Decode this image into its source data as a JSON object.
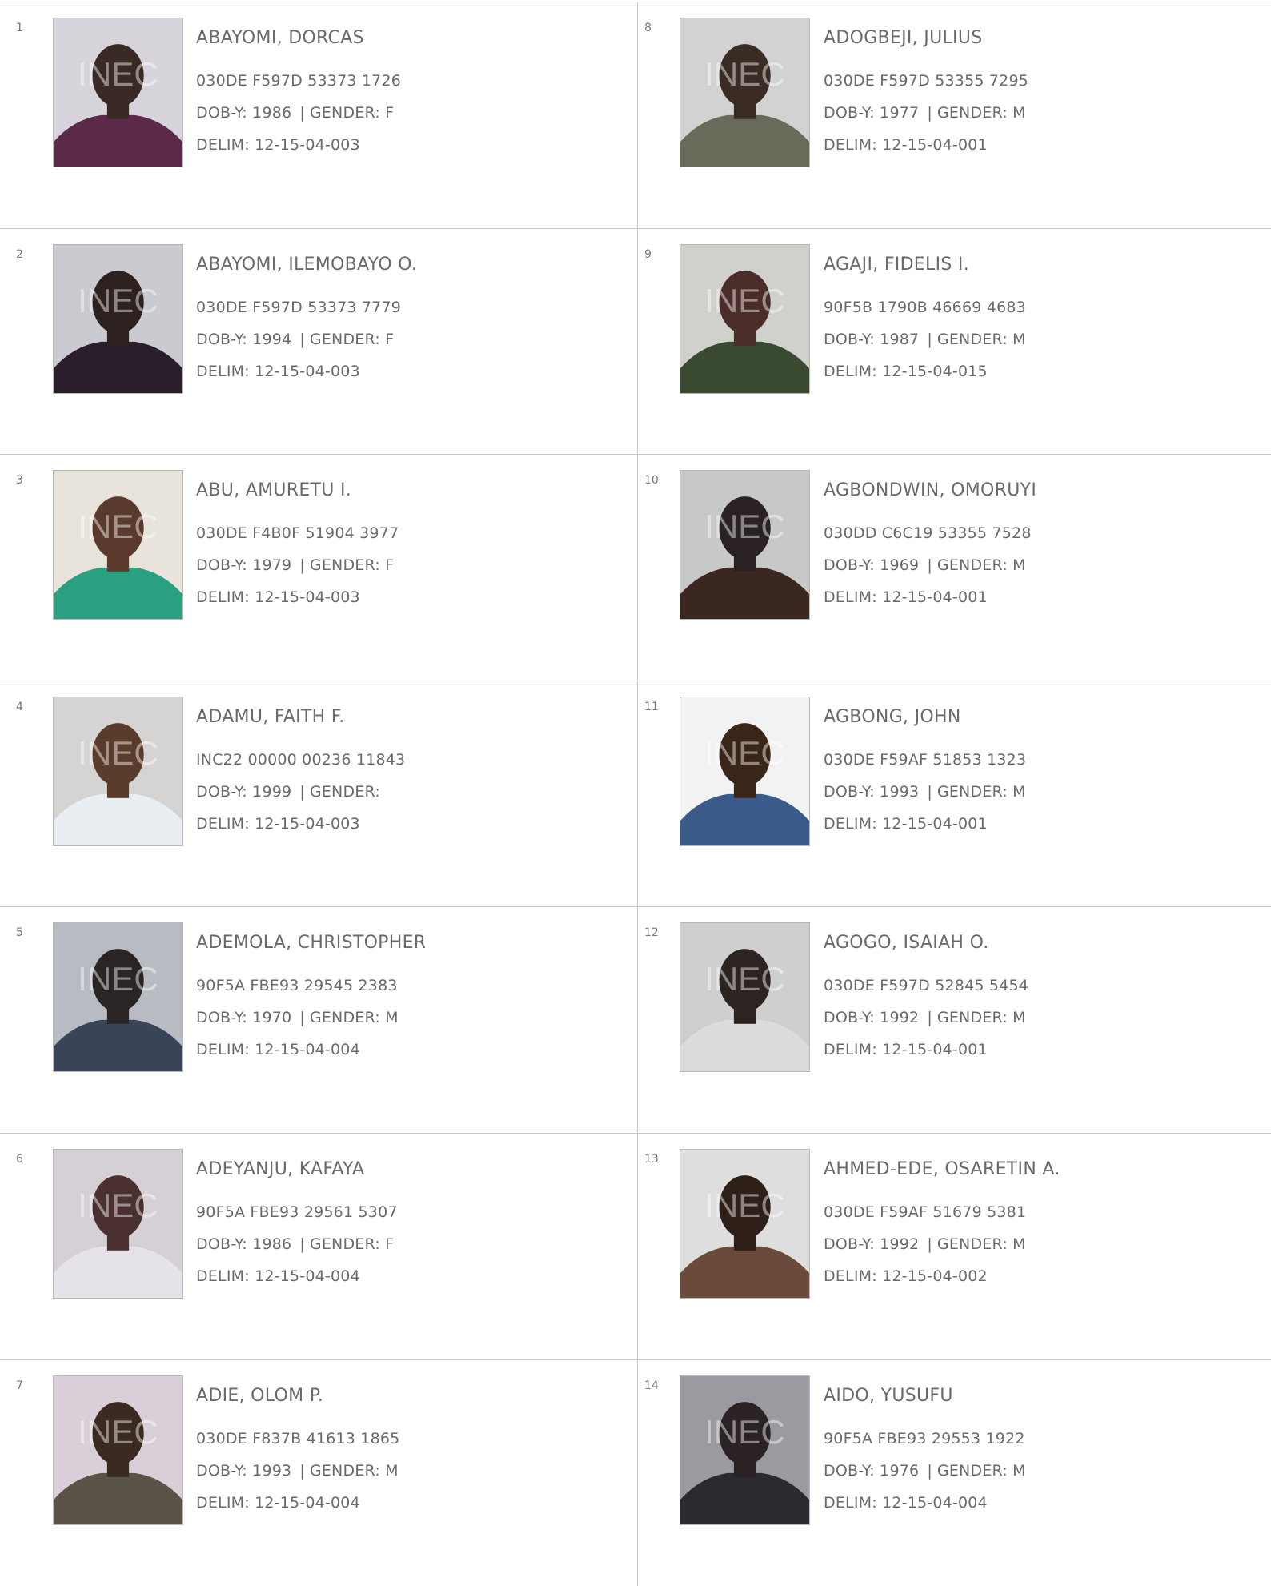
{
  "watermark": "INEC",
  "voters": [
    {
      "no": "1",
      "name": "ABAYOMI, DORCAS",
      "vin": "030DE F597D 53373 1726",
      "dob_label": "DOB-Y:",
      "dob": "1986",
      "gender_label": "GENDER:",
      "gender": "F",
      "delim_label": "DELIM:",
      "delim": "12-15-04-003",
      "bg": "#d8d4dc",
      "skin": "#3a2a26",
      "cloth": "#5a2a48"
    },
    {
      "no": "2",
      "name": "ABAYOMI, ILEMOBAYO O.",
      "vin": "030DE F597D 53373 7779",
      "dob_label": "DOB-Y:",
      "dob": "1994",
      "gender_label": "GENDER:",
      "gender": "F",
      "delim_label": "DELIM:",
      "delim": "12-15-04-003",
      "bg": "#c9cbd0",
      "skin": "#2e2220",
      "cloth": "#2a1e2a"
    },
    {
      "no": "3",
      "name": "ABU, AMURETU I.",
      "vin": "030DE F4B0F 51904 3977",
      "dob_label": "DOB-Y:",
      "dob": "1979",
      "gender_label": "GENDER:",
      "gender": "F",
      "delim_label": "DELIM:",
      "delim": "12-15-04-003",
      "bg": "#e8e4dc",
      "skin": "#5a3a2c",
      "cloth": "#2aa080"
    },
    {
      "no": "4",
      "name": "ADAMU, FAITH F.",
      "vin": "INC22 00000 00236 11843",
      "dob_label": "DOB-Y:",
      "dob": "1999",
      "gender_label": "GENDER:",
      "gender": "",
      "delim_label": "DELIM:",
      "delim": "12-15-04-003",
      "bg": "#d6d4d2",
      "skin": "#5a3c2c",
      "cloth": "#e8eef2"
    },
    {
      "no": "5",
      "name": "ADEMOLA, CHRISTOPHER",
      "vin": "90F5A FBE93 29545 2383",
      "dob_label": "DOB-Y:",
      "dob": "1970",
      "gender_label": "GENDER:",
      "gender": "M",
      "delim_label": "DELIM:",
      "delim": "12-15-04-004",
      "bg": "#b8bcc2",
      "skin": "#2a2424",
      "cloth": "#3a4458"
    },
    {
      "no": "6",
      "name": "ADEYANJU, KAFAYA",
      "vin": "90F5A FBE93 29561 5307",
      "dob_label": "DOB-Y:",
      "dob": "1986",
      "gender_label": "GENDER:",
      "gender": "F",
      "delim_label": "DELIM:",
      "delim": "12-15-04-004",
      "bg": "#d4d0d6",
      "skin": "#4a3030",
      "cloth": "#e6e2ea"
    },
    {
      "no": "7",
      "name": "ADIE, OLOM P.",
      "vin": "030DE F837B 41613 1865",
      "dob_label": "DOB-Y:",
      "dob": "1993",
      "gender_label": "GENDER:",
      "gender": "M",
      "delim_label": "DELIM:",
      "delim": "12-15-04-004",
      "bg": "#d8cfd8",
      "skin": "#3a2a22",
      "cloth": "#5a5448"
    },
    {
      "no": "8",
      "name": "ADOGBEJI, JULIUS",
      "vin": "030DE F597D 53355 7295",
      "dob_label": "DOB-Y:",
      "dob": "1977",
      "gender_label": "GENDER:",
      "gender": "M",
      "delim_label": "DELIM:",
      "delim": "12-15-04-001",
      "bg": "#d2d2d2",
      "skin": "#3a2c24",
      "cloth": "#6a6a5a"
    },
    {
      "no": "9",
      "name": "AGAJI, FIDELIS I.",
      "vin": "90F5B 1790B 46669 4683",
      "dob_label": "DOB-Y:",
      "dob": "1987",
      "gender_label": "GENDER:",
      "gender": "M",
      "delim_label": "DELIM:",
      "delim": "12-15-04-015",
      "bg": "#d0d0cc",
      "skin": "#4a2c28",
      "cloth": "#3a4a30"
    },
    {
      "no": "10",
      "name": "AGBONDWIN, OMORUYI",
      "vin": "030DD C6C19 53355 7528",
      "dob_label": "DOB-Y:",
      "dob": "1969",
      "gender_label": "GENDER:",
      "gender": "M",
      "delim_label": "DELIM:",
      "delim": "12-15-04-001",
      "bg": "#c8c8c8",
      "skin": "#2a2222",
      "cloth": "#3a2820"
    },
    {
      "no": "11",
      "name": "AGBONG, JOHN",
      "vin": "030DE F59AF 51853 1323",
      "dob_label": "DOB-Y:",
      "dob": "1993",
      "gender_label": "GENDER:",
      "gender": "M",
      "delim_label": "DELIM:",
      "delim": "12-15-04-001",
      "bg": "#f2f2f2",
      "skin": "#3a2618",
      "cloth": "#3a5a8a"
    },
    {
      "no": "12",
      "name": "AGOGO, ISAIAH O.",
      "vin": "030DE F597D 52845 5454",
      "dob_label": "DOB-Y:",
      "dob": "1992",
      "gender_label": "GENDER:",
      "gender": "M",
      "delim_label": "DELIM:",
      "delim": "12-15-04-001",
      "bg": "#cfcfcf",
      "skin": "#2c2420",
      "cloth": "#dcdcdc"
    },
    {
      "no": "13",
      "name": "AHMED-EDE, OSARETIN A.",
      "vin": "030DE F59AF 51679 5381",
      "dob_label": "DOB-Y:",
      "dob": "1992",
      "gender_label": "GENDER:",
      "gender": "M",
      "delim_label": "DELIM:",
      "delim": "12-15-04-002",
      "bg": "#dedede",
      "skin": "#2e2018",
      "cloth": "#6a4a3a"
    },
    {
      "no": "14",
      "name": "AIDO, YUSUFU",
      "vin": "90F5A FBE93 29553 1922",
      "dob_label": "DOB-Y:",
      "dob": "1976",
      "gender_label": "GENDER:",
      "gender": "M",
      "delim_label": "DELIM:",
      "delim": "12-15-04-004",
      "bg": "#9a9aa0",
      "skin": "#2a2224",
      "cloth": "#2a2a30"
    }
  ]
}
